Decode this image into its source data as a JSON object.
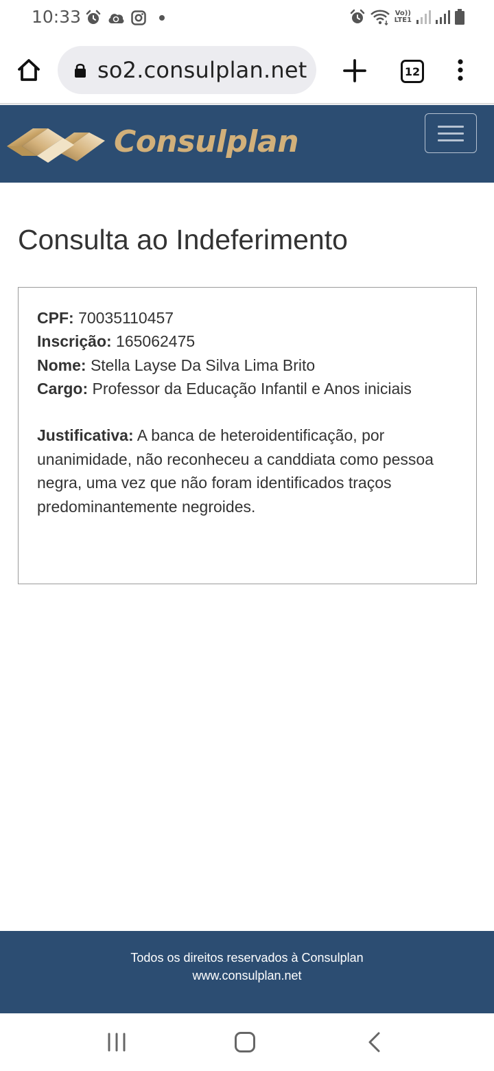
{
  "status_bar": {
    "time": "10:33",
    "left_icons": [
      "alarm-icon",
      "cloud-sync-icon",
      "instagram-icon",
      "notification-dot-icon"
    ],
    "right_icons": [
      "alarm-icon",
      "wifi-icon",
      "volte-lte-icon",
      "signal-icon",
      "signal-icon",
      "battery-icon"
    ],
    "volte_label": "Vo))",
    "lte_label": "LTE1"
  },
  "browser": {
    "url": "so2.consulplan.net",
    "tab_count": "12",
    "icons": [
      "home-icon",
      "lock-icon",
      "plus-icon",
      "tabs-icon",
      "more-vert-icon"
    ]
  },
  "header": {
    "logo_text": "Consulplan",
    "menu_icon": "hamburger-icon"
  },
  "main": {
    "title": "Consulta ao Indeferimento",
    "fields": [
      {
        "label": "CPF:",
        "value": "70035110457"
      },
      {
        "label": "Inscrição:",
        "value": "165062475"
      },
      {
        "label": "Nome:",
        "value": "Stella Layse Da Silva Lima Brito"
      },
      {
        "label": "Cargo:",
        "value": "Professor da Educação Infantil e Anos iniciais"
      }
    ],
    "justification_label": "Justificativa:",
    "justification_text": "A banca de heteroidentificação, por unanimidade, não reconheceu a canddiata como pessoa negra, uma vez que não foram identificados traços predominantemente negroides."
  },
  "footer": {
    "line1": "Todos os direitos reservados à Consulplan",
    "line2": "www.consulplan.net"
  },
  "nav_bar": {
    "icons": [
      "recents-icon",
      "home-button-icon",
      "back-icon"
    ]
  },
  "colors": {
    "header_bg": "#2c4d72",
    "logo_gold": "#d2b07a",
    "text": "#333333"
  }
}
